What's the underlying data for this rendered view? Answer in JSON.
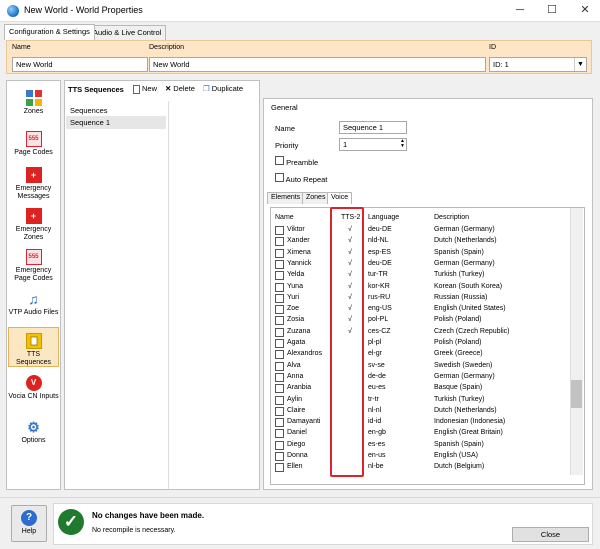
{
  "window": {
    "title": "New World - World Properties",
    "minimize": "─",
    "maximize": "☐",
    "close": "✕"
  },
  "top_tabs": [
    {
      "label": "Configuration & Settings"
    },
    {
      "label": "Audio & Live Control"
    }
  ],
  "world": {
    "name_label": "Name",
    "name_value": "New World",
    "desc_label": "Description",
    "desc_value": "New World",
    "id_label": "ID",
    "id_value": "ID: 1"
  },
  "nav": [
    {
      "label": "Zones"
    },
    {
      "label": "Page Codes"
    },
    {
      "label": "Emergency Messages"
    },
    {
      "label": "Emergency Zones"
    },
    {
      "label": "Emergency Page Codes"
    },
    {
      "label": "VTP Audio Files"
    },
    {
      "label": "TTS Sequences"
    },
    {
      "label": "Vocia CN Inputs"
    },
    {
      "label": "Options"
    }
  ],
  "toolbar": {
    "title": "TTS Sequences",
    "new": "New",
    "delete": "Delete",
    "duplicate": "Duplicate"
  },
  "sequences": {
    "header": "Sequences",
    "items": [
      "Sequence 1"
    ]
  },
  "general": {
    "group_label": "General",
    "name_label": "Name",
    "name_value": "Sequence 1",
    "priority_label": "Priority",
    "priority_value": "1",
    "preamble_label": "Preamble",
    "auto_repeat_label": "Auto Repeat"
  },
  "sub_tabs": [
    "Elements",
    "Zones",
    "Voice"
  ],
  "voice_table": {
    "headers": {
      "name": "Name",
      "tts2": "TTS-2",
      "language": "Language",
      "description": "Description"
    },
    "rows": [
      {
        "name": "Viktor",
        "tts2": "√",
        "language": "deu-DE",
        "description": "German (Germany)"
      },
      {
        "name": "Xander",
        "tts2": "√",
        "language": "nld-NL",
        "description": "Dutch (Netherlands)"
      },
      {
        "name": "Ximena",
        "tts2": "√",
        "language": "esp-ES",
        "description": "Spanish (Spain)"
      },
      {
        "name": "Yannick",
        "tts2": "√",
        "language": "deu-DE",
        "description": "German (Germany)"
      },
      {
        "name": "Yelda",
        "tts2": "√",
        "language": "tur-TR",
        "description": "Turkish (Turkey)"
      },
      {
        "name": "Yuna",
        "tts2": "√",
        "language": "kor-KR",
        "description": "Korean (South Korea)"
      },
      {
        "name": "Yuri",
        "tts2": "√",
        "language": "rus-RU",
        "description": "Russian (Russia)"
      },
      {
        "name": "Zoe",
        "tts2": "√",
        "language": "eng-US",
        "description": "English (United States)"
      },
      {
        "name": "Zosia",
        "tts2": "√",
        "language": "pol-PL",
        "description": "Polish (Poland)"
      },
      {
        "name": "Zuzana",
        "tts2": "√",
        "language": "ces-CZ",
        "description": "Czech (Czech Republic)"
      },
      {
        "name": "Agata",
        "tts2": "",
        "language": "pl-pl",
        "description": "Polish (Poland)"
      },
      {
        "name": "Alexandros",
        "tts2": "",
        "language": "el-gr",
        "description": "Greek (Greece)"
      },
      {
        "name": "Alva",
        "tts2": "",
        "language": "sv-se",
        "description": "Swedish (Sweden)"
      },
      {
        "name": "Anna",
        "tts2": "",
        "language": "de-de",
        "description": "German (Germany)"
      },
      {
        "name": "Aranbia",
        "tts2": "",
        "language": "eu-es",
        "description": "Basque (Spain)"
      },
      {
        "name": "Aylin",
        "tts2": "",
        "language": "tr-tr",
        "description": "Turkish (Turkey)"
      },
      {
        "name": "Claire",
        "tts2": "",
        "language": "nl-nl",
        "description": "Dutch (Netherlands)"
      },
      {
        "name": "Damayanti",
        "tts2": "",
        "language": "id-id",
        "description": "Indonesian (Indonesia)"
      },
      {
        "name": "Daniel",
        "tts2": "",
        "language": "en-gb",
        "description": "English (Great Britain)"
      },
      {
        "name": "Diego",
        "tts2": "",
        "language": "es-es",
        "description": "Spanish (Spain)"
      },
      {
        "name": "Donna",
        "tts2": "",
        "language": "en-us",
        "description": "English (USA)"
      },
      {
        "name": "Ellen",
        "tts2": "",
        "language": "nl-be",
        "description": "Dutch (Belgium)"
      }
    ]
  },
  "status": {
    "help_label": "Help",
    "title": "No changes have been made.",
    "detail": "No recompile is necessary.",
    "close_label": "Close"
  }
}
